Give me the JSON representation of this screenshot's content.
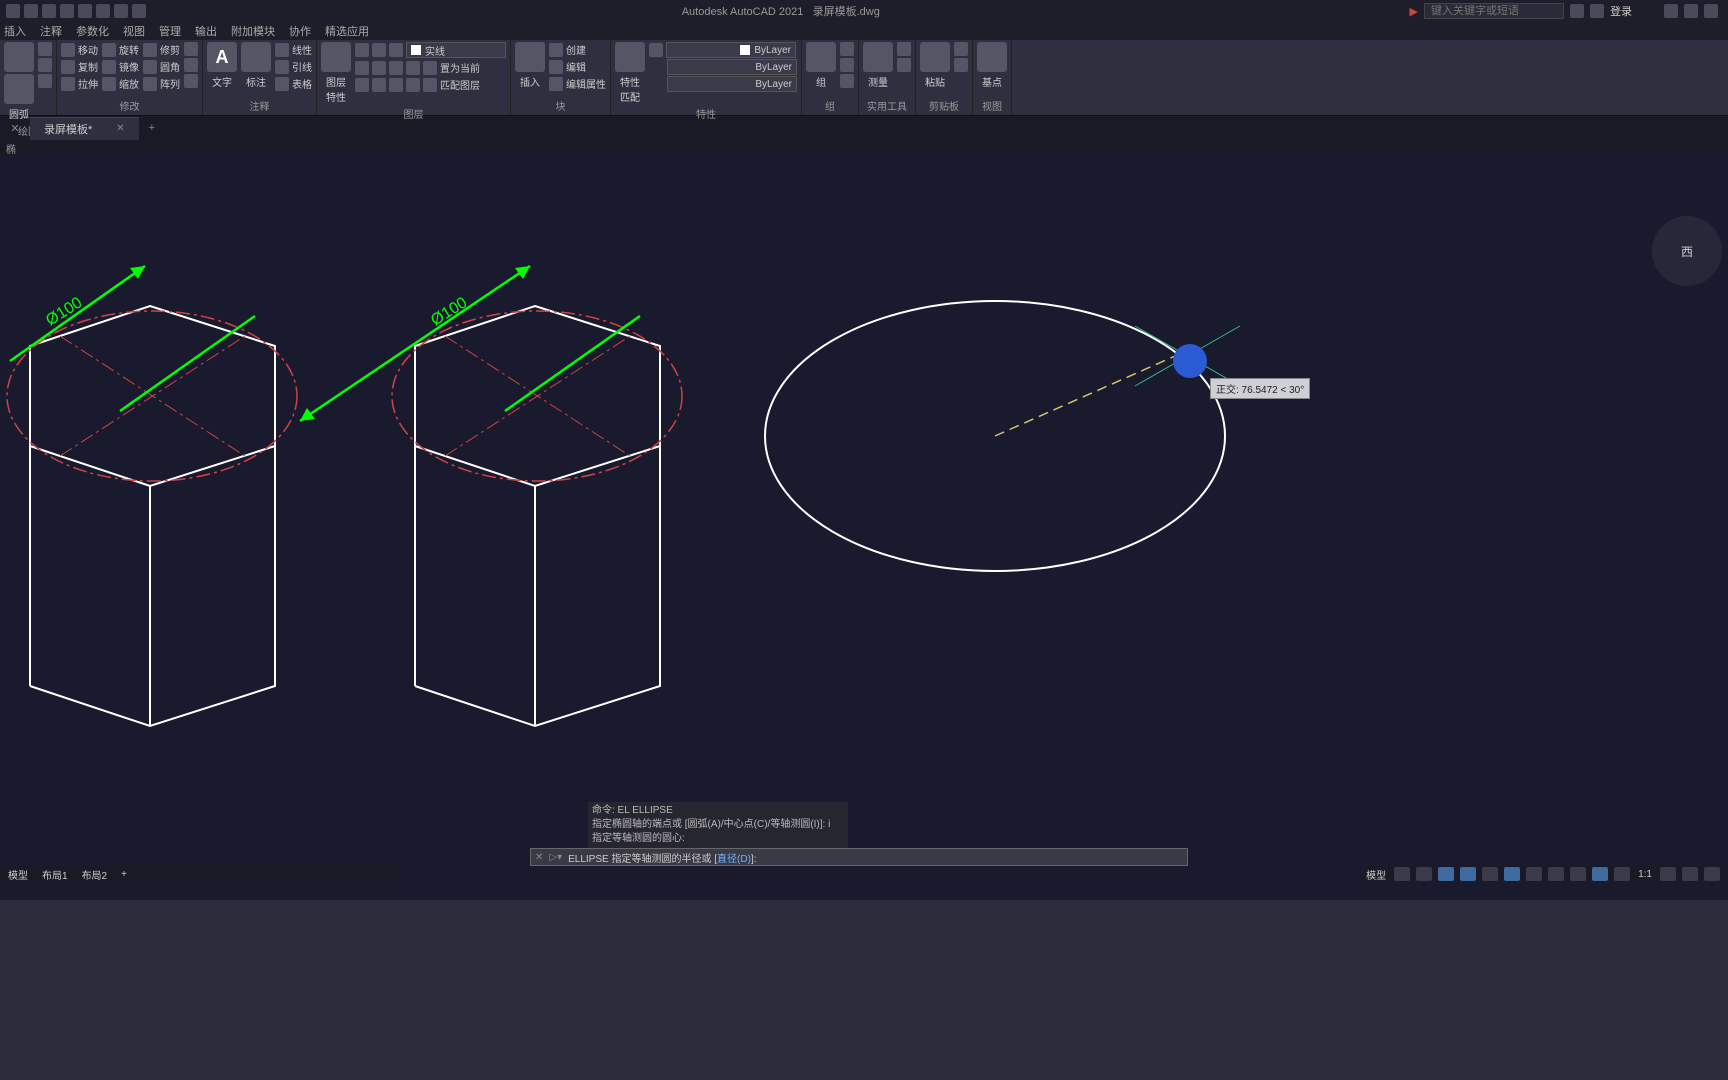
{
  "title": {
    "app": "Autodesk AutoCAD 2021",
    "file": "录屏模板.dwg"
  },
  "search": {
    "placeholder": "键入关键字或短语"
  },
  "login": "登录",
  "menus": [
    "插入",
    "注释",
    "参数化",
    "视图",
    "管理",
    "输出",
    "附加模块",
    "协作",
    "精选应用"
  ],
  "ribbon": {
    "draw": {
      "arc": "圆弧",
      "label": "绘图"
    },
    "modify": {
      "move": "移动",
      "rotate": "旋转",
      "trim": "修剪",
      "copy": "复制",
      "mirror": "镜像",
      "fillet": "圆角",
      "stretch": "拉伸",
      "scale": "缩放",
      "array": "阵列",
      "label": "修改"
    },
    "annot": {
      "text": "文字",
      "dim": "标注",
      "linear": "线性",
      "leader": "引线",
      "table": "表格",
      "label": "注释"
    },
    "layers": {
      "props": "图层\n特性",
      "sel": "实线",
      "match": "匹配图层",
      "label": "图层"
    },
    "block": {
      "insert": "插入",
      "create": "创建",
      "edit": "编辑",
      "editattr": "编辑属性",
      "label": "块"
    },
    "props": {
      "match": "特性\n匹配",
      "bylayer1": "ByLayer",
      "bylayer2": "ByLayer",
      "bylayer3": "ByLayer",
      "label": "特性"
    },
    "group": {
      "btn": "组",
      "label": "组"
    },
    "util": {
      "meas": "测量",
      "label": "实用工具"
    },
    "clip": {
      "paste": "粘贴",
      "label": "剪贴板"
    },
    "view": {
      "base": "基点",
      "label": "视图"
    },
    "setcur": "置为当前"
  },
  "doctab": {
    "name": "录屏模板*"
  },
  "smalllabel": "椭",
  "dims": {
    "d1": "Ø100",
    "d2": "Ø100"
  },
  "tooltip": "正交: 76.5472 < 30°",
  "viewcube": "西",
  "cmd": {
    "h1": "命令: EL ELLIPSE",
    "h2": "指定椭圆轴的端点或 [圆弧(A)/中心点(C)/等轴测圆(I)]: i",
    "h3": "指定等轴测圆的圆心:",
    "prompt_a": "ELLIPSE 指定等轴测圆的半径或 [",
    "prompt_opt": "直径(D)",
    "prompt_b": "]:"
  },
  "bottomtabs": [
    "模型",
    "布局1",
    "布局2",
    "+"
  ],
  "status": {
    "model": "模型",
    "scale": "1:1"
  }
}
